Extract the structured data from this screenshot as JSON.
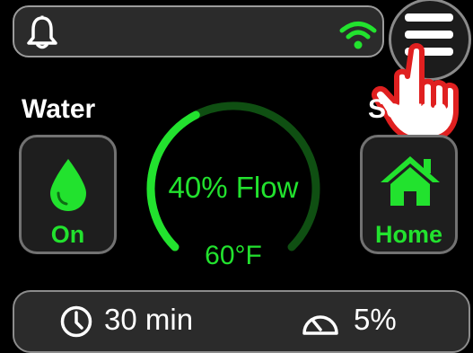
{
  "colors": {
    "accent_green": "#22e22e",
    "dial_track_dark_green": "#0f4f12",
    "alert_red": "#e02020"
  },
  "status_bar": {
    "left_icon": "bell-icon",
    "right_icon": "wifi-icon",
    "wifi_active": true
  },
  "menu": {
    "icon": "hamburger-menu-icon",
    "pointer_icon": "pointing-hand-icon"
  },
  "water": {
    "label": "Water",
    "icon": "water-drop-icon",
    "state": "On"
  },
  "scene": {
    "label": "Scene",
    "icon": "home-icon",
    "value": "Home"
  },
  "dial": {
    "flow_percent": 40,
    "flow_text": "40% Flow",
    "temperature_text": "60°F"
  },
  "bottom_bar": {
    "timer_icon": "clock-icon",
    "timer_text": "30 min",
    "gauge_icon": "gauge-icon",
    "gauge_text": "5%"
  }
}
